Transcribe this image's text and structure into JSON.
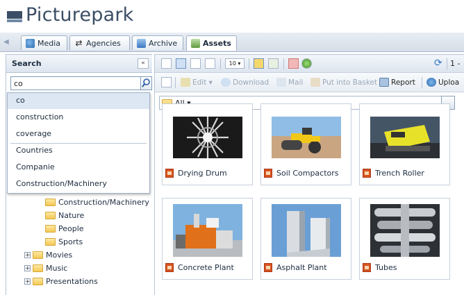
{
  "app": {
    "title": "Picturepark",
    "brand_color": "#3b4e66"
  },
  "tabs": [
    {
      "label": "Media",
      "icon": "media-icon",
      "active": false
    },
    {
      "label": "Agencies",
      "icon": "arrows-icon",
      "active": false
    },
    {
      "label": "Archive",
      "icon": "archive-icon",
      "active": false
    },
    {
      "label": "Assets",
      "icon": "assets-icon",
      "active": true
    }
  ],
  "search": {
    "panel_title": "Search",
    "value": "co",
    "suggestions": [
      "co",
      "construction",
      "coverage",
      "Countries",
      "Companie",
      "Construction/Machinery"
    ],
    "selected_index": 0
  },
  "tree": {
    "items": [
      {
        "label": "Construction/Machinery",
        "level": 2,
        "expandable": false
      },
      {
        "label": "Nature",
        "level": 2,
        "expandable": false
      },
      {
        "label": "People",
        "level": 2,
        "expandable": false
      },
      {
        "label": "Sports",
        "level": 2,
        "expandable": false
      },
      {
        "label": "Movies",
        "level": 1,
        "expandable": true
      },
      {
        "label": "Music",
        "level": 1,
        "expandable": true
      },
      {
        "label": "Presentations",
        "level": 1,
        "expandable": true
      }
    ]
  },
  "toolbar": {
    "page_size": "10",
    "page_indicator": "1 -",
    "actions": [
      {
        "label": "Edit ▾",
        "enabled": false,
        "icon": "edit-icon"
      },
      {
        "label": "Download",
        "enabled": false,
        "icon": "download-icon"
      },
      {
        "label": "Mail",
        "enabled": false,
        "icon": "mail-icon"
      },
      {
        "label": "Put into Basket",
        "enabled": false,
        "icon": "basket-icon"
      },
      {
        "label": "Report",
        "enabled": true,
        "icon": "report-icon"
      },
      {
        "label": "Uploa",
        "enabled": true,
        "icon": "upload-icon"
      }
    ]
  },
  "filter": {
    "value": "All ▾"
  },
  "assets": [
    {
      "title": "Drying Drum",
      "scene": "drum"
    },
    {
      "title": "Soil Compactors",
      "scene": "compactor"
    },
    {
      "title": "Trench Roller",
      "scene": "roller"
    },
    {
      "title": "Concrete Plant",
      "scene": "concrete"
    },
    {
      "title": "Asphalt Plant",
      "scene": "asphalt"
    },
    {
      "title": "Tubes",
      "scene": "tubes"
    }
  ]
}
